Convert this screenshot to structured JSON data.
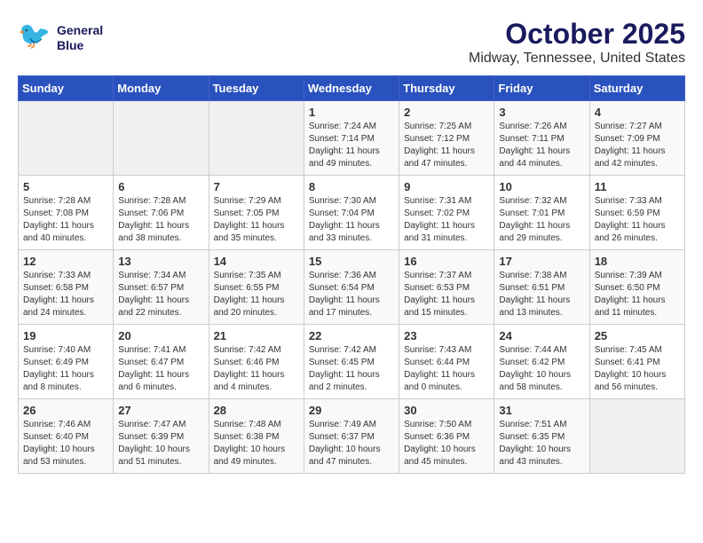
{
  "header": {
    "logo_line1": "General",
    "logo_line2": "Blue",
    "month": "October 2025",
    "location": "Midway, Tennessee, United States"
  },
  "weekdays": [
    "Sunday",
    "Monday",
    "Tuesday",
    "Wednesday",
    "Thursday",
    "Friday",
    "Saturday"
  ],
  "weeks": [
    [
      {
        "day": "",
        "info": ""
      },
      {
        "day": "",
        "info": ""
      },
      {
        "day": "",
        "info": ""
      },
      {
        "day": "1",
        "info": "Sunrise: 7:24 AM\nSunset: 7:14 PM\nDaylight: 11 hours\nand 49 minutes."
      },
      {
        "day": "2",
        "info": "Sunrise: 7:25 AM\nSunset: 7:12 PM\nDaylight: 11 hours\nand 47 minutes."
      },
      {
        "day": "3",
        "info": "Sunrise: 7:26 AM\nSunset: 7:11 PM\nDaylight: 11 hours\nand 44 minutes."
      },
      {
        "day": "4",
        "info": "Sunrise: 7:27 AM\nSunset: 7:09 PM\nDaylight: 11 hours\nand 42 minutes."
      }
    ],
    [
      {
        "day": "5",
        "info": "Sunrise: 7:28 AM\nSunset: 7:08 PM\nDaylight: 11 hours\nand 40 minutes."
      },
      {
        "day": "6",
        "info": "Sunrise: 7:28 AM\nSunset: 7:06 PM\nDaylight: 11 hours\nand 38 minutes."
      },
      {
        "day": "7",
        "info": "Sunrise: 7:29 AM\nSunset: 7:05 PM\nDaylight: 11 hours\nand 35 minutes."
      },
      {
        "day": "8",
        "info": "Sunrise: 7:30 AM\nSunset: 7:04 PM\nDaylight: 11 hours\nand 33 minutes."
      },
      {
        "day": "9",
        "info": "Sunrise: 7:31 AM\nSunset: 7:02 PM\nDaylight: 11 hours\nand 31 minutes."
      },
      {
        "day": "10",
        "info": "Sunrise: 7:32 AM\nSunset: 7:01 PM\nDaylight: 11 hours\nand 29 minutes."
      },
      {
        "day": "11",
        "info": "Sunrise: 7:33 AM\nSunset: 6:59 PM\nDaylight: 11 hours\nand 26 minutes."
      }
    ],
    [
      {
        "day": "12",
        "info": "Sunrise: 7:33 AM\nSunset: 6:58 PM\nDaylight: 11 hours\nand 24 minutes."
      },
      {
        "day": "13",
        "info": "Sunrise: 7:34 AM\nSunset: 6:57 PM\nDaylight: 11 hours\nand 22 minutes."
      },
      {
        "day": "14",
        "info": "Sunrise: 7:35 AM\nSunset: 6:55 PM\nDaylight: 11 hours\nand 20 minutes."
      },
      {
        "day": "15",
        "info": "Sunrise: 7:36 AM\nSunset: 6:54 PM\nDaylight: 11 hours\nand 17 minutes."
      },
      {
        "day": "16",
        "info": "Sunrise: 7:37 AM\nSunset: 6:53 PM\nDaylight: 11 hours\nand 15 minutes."
      },
      {
        "day": "17",
        "info": "Sunrise: 7:38 AM\nSunset: 6:51 PM\nDaylight: 11 hours\nand 13 minutes."
      },
      {
        "day": "18",
        "info": "Sunrise: 7:39 AM\nSunset: 6:50 PM\nDaylight: 11 hours\nand 11 minutes."
      }
    ],
    [
      {
        "day": "19",
        "info": "Sunrise: 7:40 AM\nSunset: 6:49 PM\nDaylight: 11 hours\nand 8 minutes."
      },
      {
        "day": "20",
        "info": "Sunrise: 7:41 AM\nSunset: 6:47 PM\nDaylight: 11 hours\nand 6 minutes."
      },
      {
        "day": "21",
        "info": "Sunrise: 7:42 AM\nSunset: 6:46 PM\nDaylight: 11 hours\nand 4 minutes."
      },
      {
        "day": "22",
        "info": "Sunrise: 7:42 AM\nSunset: 6:45 PM\nDaylight: 11 hours\nand 2 minutes."
      },
      {
        "day": "23",
        "info": "Sunrise: 7:43 AM\nSunset: 6:44 PM\nDaylight: 11 hours\nand 0 minutes."
      },
      {
        "day": "24",
        "info": "Sunrise: 7:44 AM\nSunset: 6:42 PM\nDaylight: 10 hours\nand 58 minutes."
      },
      {
        "day": "25",
        "info": "Sunrise: 7:45 AM\nSunset: 6:41 PM\nDaylight: 10 hours\nand 56 minutes."
      }
    ],
    [
      {
        "day": "26",
        "info": "Sunrise: 7:46 AM\nSunset: 6:40 PM\nDaylight: 10 hours\nand 53 minutes."
      },
      {
        "day": "27",
        "info": "Sunrise: 7:47 AM\nSunset: 6:39 PM\nDaylight: 10 hours\nand 51 minutes."
      },
      {
        "day": "28",
        "info": "Sunrise: 7:48 AM\nSunset: 6:38 PM\nDaylight: 10 hours\nand 49 minutes."
      },
      {
        "day": "29",
        "info": "Sunrise: 7:49 AM\nSunset: 6:37 PM\nDaylight: 10 hours\nand 47 minutes."
      },
      {
        "day": "30",
        "info": "Sunrise: 7:50 AM\nSunset: 6:36 PM\nDaylight: 10 hours\nand 45 minutes."
      },
      {
        "day": "31",
        "info": "Sunrise: 7:51 AM\nSunset: 6:35 PM\nDaylight: 10 hours\nand 43 minutes."
      },
      {
        "day": "",
        "info": ""
      }
    ]
  ]
}
